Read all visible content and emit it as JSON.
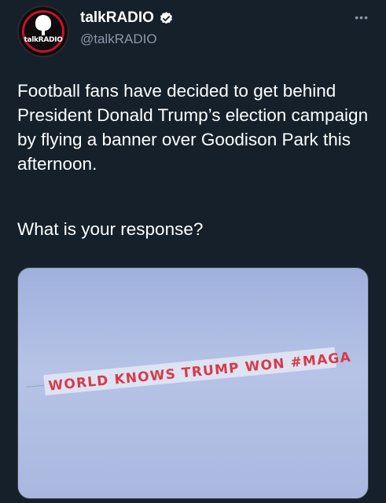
{
  "author": {
    "display_name": "talkRADIO",
    "handle": "@talkRADIO",
    "verified": true,
    "avatar_logo_text": "talkRADIO"
  },
  "menu_icon": "more-horizontal-icon",
  "tweet": {
    "text": "Football fans have decided to get behind President Donald Trump’s election campaign by flying a banner over Goodison Park this afternoon.",
    "question": "What is your response?"
  },
  "media": {
    "banner_text": "WORLD KNOWS TRUMP WON #MAGA"
  },
  "colors": {
    "background": "#15202b",
    "text_primary": "#ffffff",
    "text_secondary": "#8b98a5",
    "verified": "#ffffff",
    "banner_red": "#d83a48"
  }
}
